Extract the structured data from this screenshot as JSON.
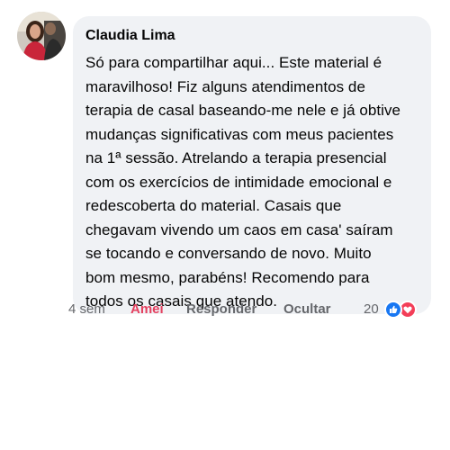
{
  "comment": {
    "author": "Claudia Lima",
    "text": "Só para compartilhar aqui... Este material é\nmaravilhoso! Fiz alguns atendimentos de\nterapia de casal baseando-me nele e já obtive\nmudanças significativas com meus pacientes\nna 1ª sessão. Atrelando a terapia presencial\ncom os exercícios de intimidade emocional e\nredescoberta do material. Casais que\nchegavam vivendo um caos em casa' saíram\nse tocando e conversando de novo. Muito\nbom mesmo, parabéns! Recomendo para\ntodos os casais que atendo.",
    "timestamp": "4 sem",
    "like_label": "Amei",
    "reply_label": "Responder",
    "hide_label": "Ocultar",
    "reaction_count": "20",
    "reactions": [
      "like-icon",
      "love-icon"
    ]
  },
  "colors": {
    "bubble": "#f0f2f5",
    "love_accent": "#e4405f",
    "like_blue": "#1877f2",
    "love_red": "#f33e58",
    "secondary_text": "#65676b"
  }
}
